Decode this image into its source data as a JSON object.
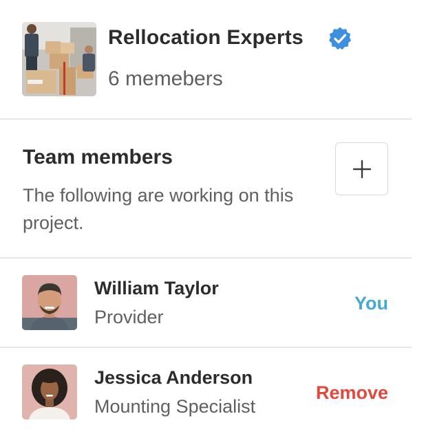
{
  "company": {
    "name": "Rellocation Experts",
    "member_count": "6 memebers",
    "verified_color": "#3f8fe0"
  },
  "team_section": {
    "title": "Team members",
    "description": "The following are working on this project.",
    "add_icon": "plus-icon"
  },
  "members": [
    {
      "name": "William Taylor",
      "role": "Provider",
      "action": "You",
      "action_color": "#45a9d6"
    },
    {
      "name": "Jessica Anderson",
      "role": "Mounting Specialist",
      "action": "Remove",
      "action_color": "#e2483d"
    }
  ]
}
